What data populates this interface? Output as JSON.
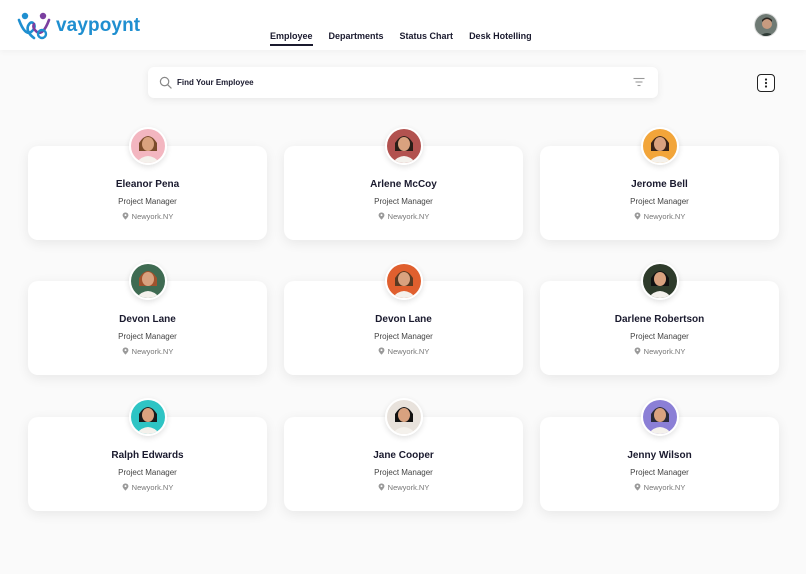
{
  "brand": {
    "name": "vaypoynt",
    "color": "#1f8fd0",
    "accent": "#7b3fa0"
  },
  "nav": {
    "tabs": [
      {
        "label": "Employee",
        "active": true
      },
      {
        "label": "Departments",
        "active": false
      },
      {
        "label": "Status Chart",
        "active": false
      },
      {
        "label": "Desk Hotelling",
        "active": false
      }
    ]
  },
  "search": {
    "placeholder": "Find Your Employee",
    "value": ""
  },
  "icons": {
    "search": "search-icon",
    "filter": "filter-icon",
    "more": "more-vertical-icon",
    "location": "map-pin-icon"
  },
  "employees": [
    {
      "name": "Eleanor Pena",
      "role": "Project Manager",
      "location": "Newyork.NY",
      "avatar_bg": "#f3b6c0"
    },
    {
      "name": "Arlene McCoy",
      "role": "Project Manager",
      "location": "Newyork.NY",
      "avatar_bg": "#b2524f"
    },
    {
      "name": "Jerome Bell",
      "role": "Project Manager",
      "location": "Newyork.NY",
      "avatar_bg": "#f2a53a"
    },
    {
      "name": "Devon Lane",
      "role": "Project Manager",
      "location": "Newyork.NY",
      "avatar_bg": "#3f6b52"
    },
    {
      "name": "Devon Lane",
      "role": "Project Manager",
      "location": "Newyork.NY",
      "avatar_bg": "#e05f2e"
    },
    {
      "name": "Darlene Robertson",
      "role": "Project Manager",
      "location": "Newyork.NY",
      "avatar_bg": "#2e3b2b"
    },
    {
      "name": "Ralph Edwards",
      "role": "Project Manager",
      "location": "Newyork.NY",
      "avatar_bg": "#2ec4c4"
    },
    {
      "name": "Jane Cooper",
      "role": "Project Manager",
      "location": "Newyork.NY",
      "avatar_bg": "#e8e2dc"
    },
    {
      "name": "Jenny Wilson",
      "role": "Project Manager",
      "location": "Newyork.NY",
      "avatar_bg": "#8b7fd6"
    }
  ]
}
